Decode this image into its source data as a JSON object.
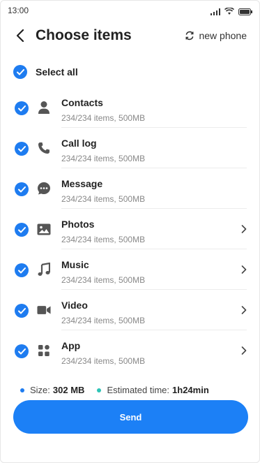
{
  "status_bar": {
    "time": "13:00"
  },
  "header": {
    "title": "Choose items",
    "new_phone_label": "new phone"
  },
  "select_all": {
    "label": "Select all",
    "checked": true
  },
  "items": [
    {
      "name": "Contacts",
      "detail": "234/234 items, 500MB",
      "icon": "person-icon",
      "checked": true,
      "has_chevron": false
    },
    {
      "name": "Call log",
      "detail": "234/234 items, 500MB",
      "icon": "phone-icon",
      "checked": true,
      "has_chevron": false
    },
    {
      "name": "Message",
      "detail": "234/234 items, 500MB",
      "icon": "message-icon",
      "checked": true,
      "has_chevron": false
    },
    {
      "name": "Photos",
      "detail": "234/234 items, 500MB",
      "icon": "image-icon",
      "checked": true,
      "has_chevron": true
    },
    {
      "name": "Music",
      "detail": "234/234 items, 500MB",
      "icon": "music-note-icon",
      "checked": true,
      "has_chevron": true
    },
    {
      "name": "Video",
      "detail": "234/234 items, 500MB",
      "icon": "video-camera-icon",
      "checked": true,
      "has_chevron": true
    },
    {
      "name": "App",
      "detail": "234/234 items, 500MB",
      "icon": "apps-grid-icon",
      "checked": true,
      "has_chevron": true
    }
  ],
  "summary": {
    "size_label": "Size:",
    "size_value": "302 MB",
    "time_label": "Estimated time:",
    "time_value": "1h24min"
  },
  "send_button": {
    "label": "Send"
  },
  "colors": {
    "accent": "#1e7cf0",
    "size_dot": "#1e7cf0",
    "time_dot": "#2ec4b6"
  }
}
